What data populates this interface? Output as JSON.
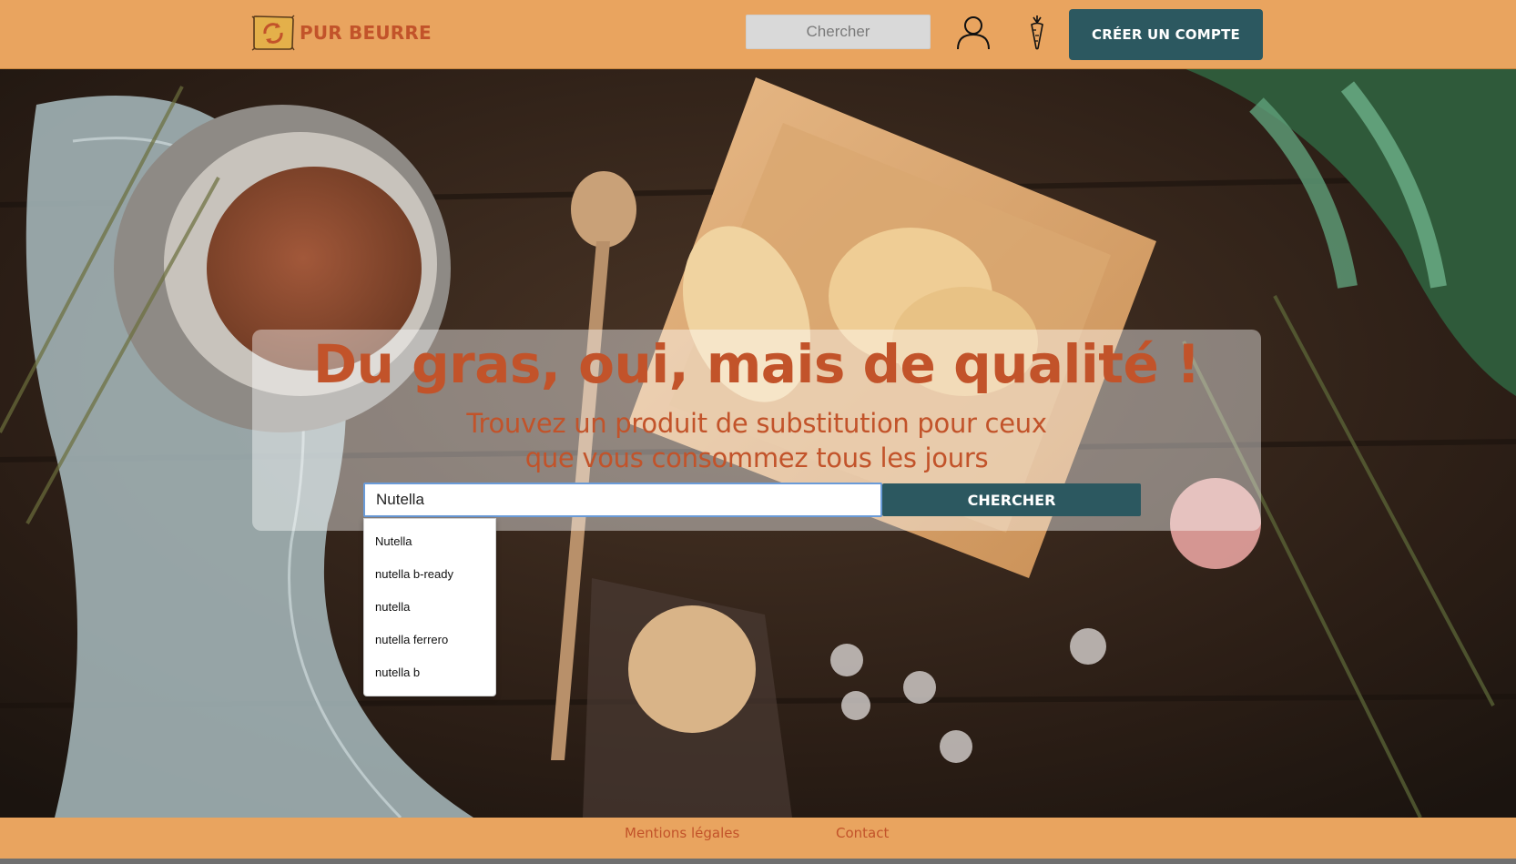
{
  "header": {
    "brand": "PUR BEURRE",
    "search_placeholder": "Chercher",
    "signup_label": "CRÉER UN COMPTE"
  },
  "icons": {
    "logo": "pur-beurre-logo",
    "user": "user-icon",
    "carrot": "carrot-icon"
  },
  "hero": {
    "title": "Du gras, oui, mais de qualité !",
    "subtitle": "Trouvez un produit de substitution pour ceux que vous consommez tous les jours",
    "search_value": "Nutella",
    "search_button": "CHERCHER",
    "suggestions": [
      "Nutella",
      "nutella b-ready",
      "nutella",
      "nutella ferrero",
      "nutella b"
    ]
  },
  "footer": {
    "legal": "Mentions légales",
    "contact": "Contact"
  },
  "colors": {
    "header_bg": "#e9a45f",
    "brand_text": "#c2532a",
    "button_bg": "#2c5860"
  }
}
